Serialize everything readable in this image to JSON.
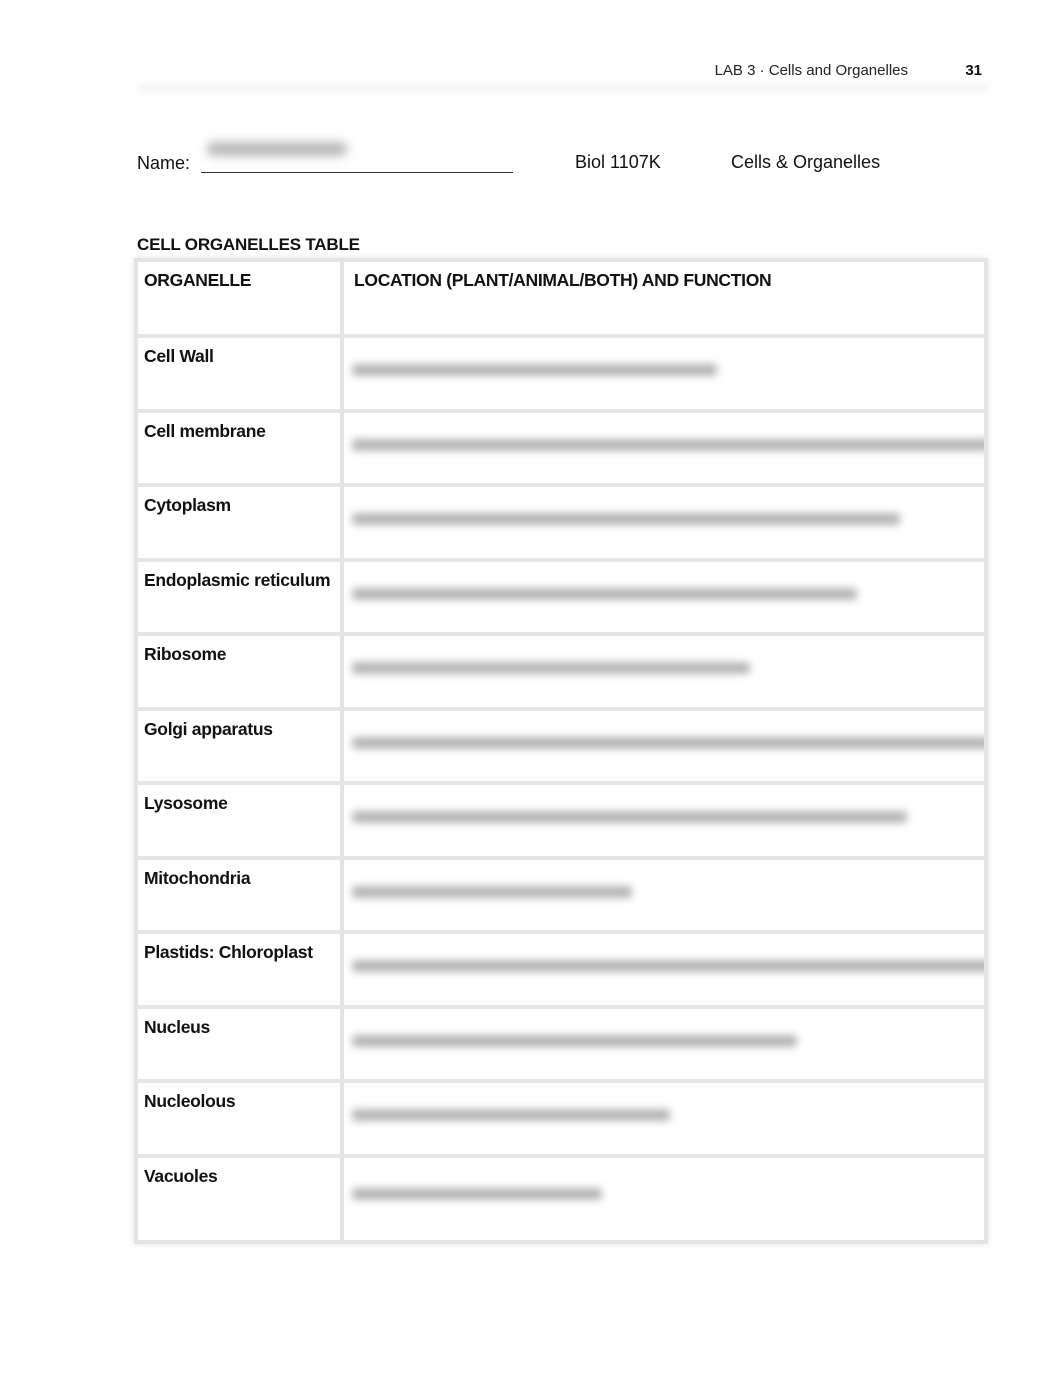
{
  "running_head": {
    "title": "LAB 3 ·  Cells and Organelles",
    "page_number": "31"
  },
  "form": {
    "name_label": "Name:",
    "name_value": "[redacted]",
    "course": "Biol 1107K",
    "topic": "Cells & Organelles"
  },
  "table": {
    "title": "CELL ORGANELLES TABLE",
    "headers": [
      "ORGANELLE",
      "LOCATION (PLANT/ANIMAL/BOTH) AND FUNCTION"
    ],
    "rows": [
      {
        "organelle": "Cell Wall",
        "answer": "[blurred]"
      },
      {
        "organelle": "Cell membrane",
        "answer": "[blurred]"
      },
      {
        "organelle": "Cytoplasm",
        "answer": "[blurred]"
      },
      {
        "organelle": "Endoplasmic reticulum",
        "answer": "[blurred]"
      },
      {
        "organelle": "Ribosome",
        "answer": "[blurred]"
      },
      {
        "organelle": "Golgi apparatus",
        "answer": "[blurred]"
      },
      {
        "organelle": "Lysosome",
        "answer": "[blurred]"
      },
      {
        "organelle": "Mitochondria",
        "answer": "[blurred]"
      },
      {
        "organelle": "Plastids: Chloroplast",
        "answer": "[blurred]"
      },
      {
        "organelle": "Nucleus",
        "answer": "[blurred]"
      },
      {
        "organelle": "Nucleolous",
        "answer": "[blurred]"
      },
      {
        "organelle": "Vacuoles",
        "answer": "[blurred]"
      }
    ]
  }
}
